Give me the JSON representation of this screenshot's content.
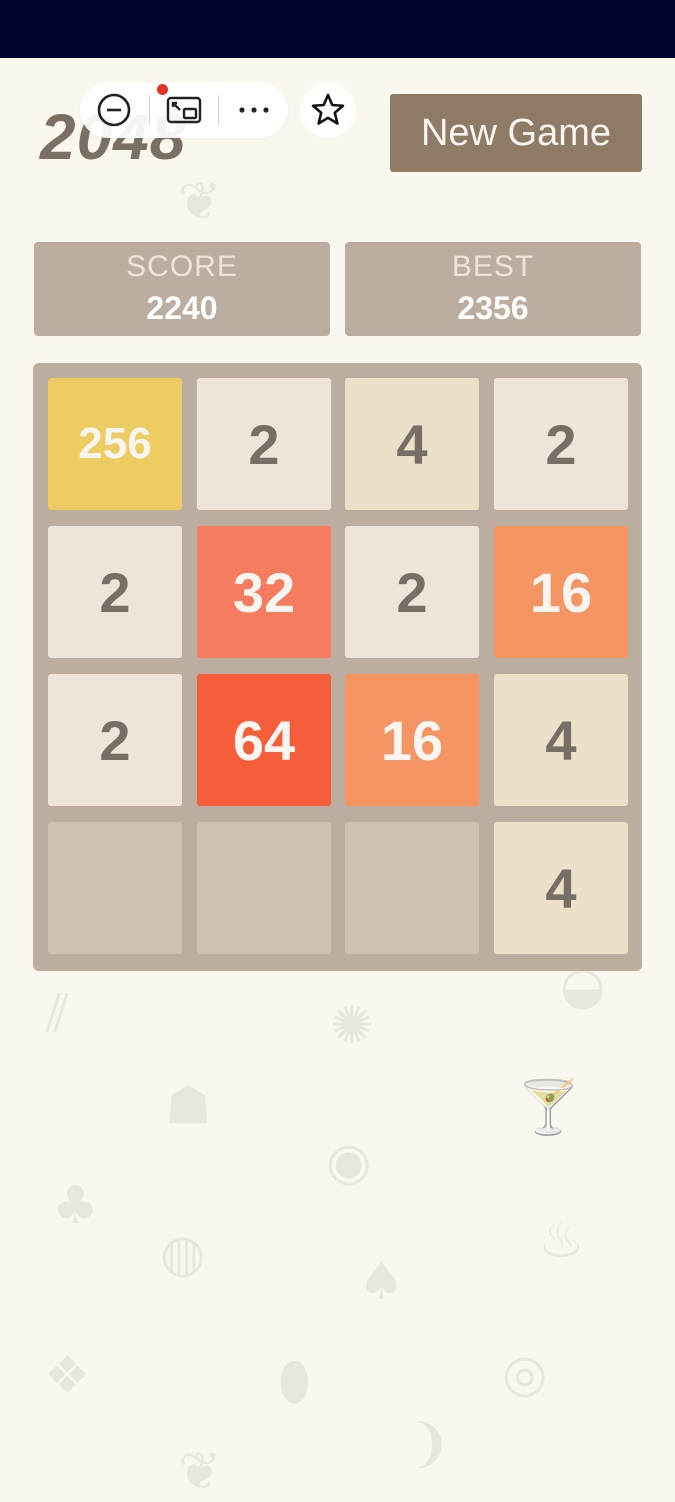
{
  "game": {
    "title": "2048",
    "new_game_label": "New Game",
    "score_label": "SCORE",
    "score_value": "2240",
    "best_label": "BEST",
    "best_value": "2356"
  },
  "toolbar": {
    "icons": [
      "minus-circle-icon",
      "picture-in-picture-icon",
      "more-icon",
      "star-icon"
    ],
    "notification_dot_color": "#e53027"
  },
  "board": {
    "rows": [
      [
        "256",
        "2",
        "4",
        "2"
      ],
      [
        "2",
        "32",
        "2",
        "16"
      ],
      [
        "2",
        "64",
        "16",
        "4"
      ],
      [
        "",
        "",
        "",
        "4"
      ]
    ]
  },
  "colors": {
    "status_bar": "#02022e",
    "background": "#faf8ee",
    "board": "#bbada0",
    "new_game_button": "#8f7a66",
    "tile_empty": "#cdc1b4",
    "tile_2": "#eee4da",
    "tile_4": "#ede0c8",
    "tile_16": "#f59563",
    "tile_32": "#f67c5f",
    "tile_64": "#f65e3b",
    "tile_256": "#edcc61"
  }
}
